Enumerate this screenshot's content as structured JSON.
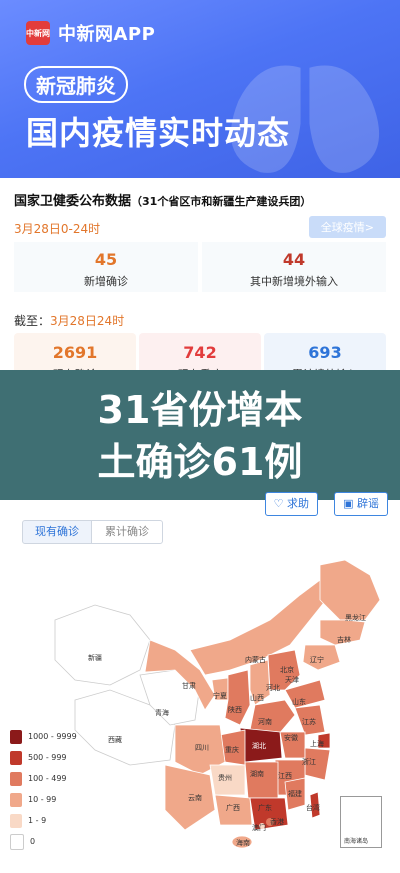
{
  "header": {
    "app_logo": "中新网",
    "app_name": "中新网APP",
    "tag": "新冠肺炎",
    "headline": "国内疫情实时动态"
  },
  "card": {
    "title": "国家卫健委公布数据",
    "title_note": "（31个省区市和新疆生产建设兵团）",
    "date_range": "3月28日0-24时",
    "global_button": "全球疫情>",
    "new_confirmed": {
      "value": "45",
      "label": "新增确诊"
    },
    "new_imported": {
      "value": "44",
      "label": "其中新增境外输入"
    },
    "as_of_prefix": "截至：",
    "as_of": "3月28日24时",
    "current_confirmed": {
      "value": "2691",
      "label": "现有确诊"
    },
    "current_severe": {
      "value": "742",
      "label": "现有重症"
    },
    "total_imported": {
      "value": "693",
      "label": "累计境外输入"
    }
  },
  "overlay": {
    "line1": "31省份增本",
    "line2": "土确诊61例"
  },
  "map": {
    "tab_current": "现有确诊",
    "tab_total": "累计确诊",
    "help_button": "求助",
    "rumor_button": "辟谣",
    "legend": [
      {
        "label": "1000 - 9999",
        "color": "#8b1a1a"
      },
      {
        "label": "500 - 999",
        "color": "#c0392b"
      },
      {
        "label": "100 - 499",
        "color": "#e07a5f"
      },
      {
        "label": "10 - 99",
        "color": "#f0a88a"
      },
      {
        "label": "1 - 9",
        "color": "#f9d9c6"
      },
      {
        "label": "0",
        "color": "#ffffff"
      }
    ],
    "nanhai": "南海诸岛",
    "provinces": [
      "黑龙江",
      "吉林",
      "辽宁",
      "内蒙古",
      "北京",
      "天津",
      "河北",
      "山西",
      "山东",
      "宁夏",
      "甘肃",
      "陕西",
      "河南",
      "江苏",
      "安徽",
      "上海",
      "湖北",
      "四川",
      "重庆",
      "浙江",
      "江西",
      "湖南",
      "贵州",
      "云南",
      "广西",
      "广东",
      "福建",
      "台湾",
      "香港",
      "澳门",
      "海南",
      "新疆",
      "西藏",
      "青海"
    ]
  },
  "colors": {
    "banner": "#4d74f5",
    "orange": "#e2762b",
    "red": "#e23c3c",
    "blue": "#2e74d8",
    "overlay": "#3f6f73"
  }
}
